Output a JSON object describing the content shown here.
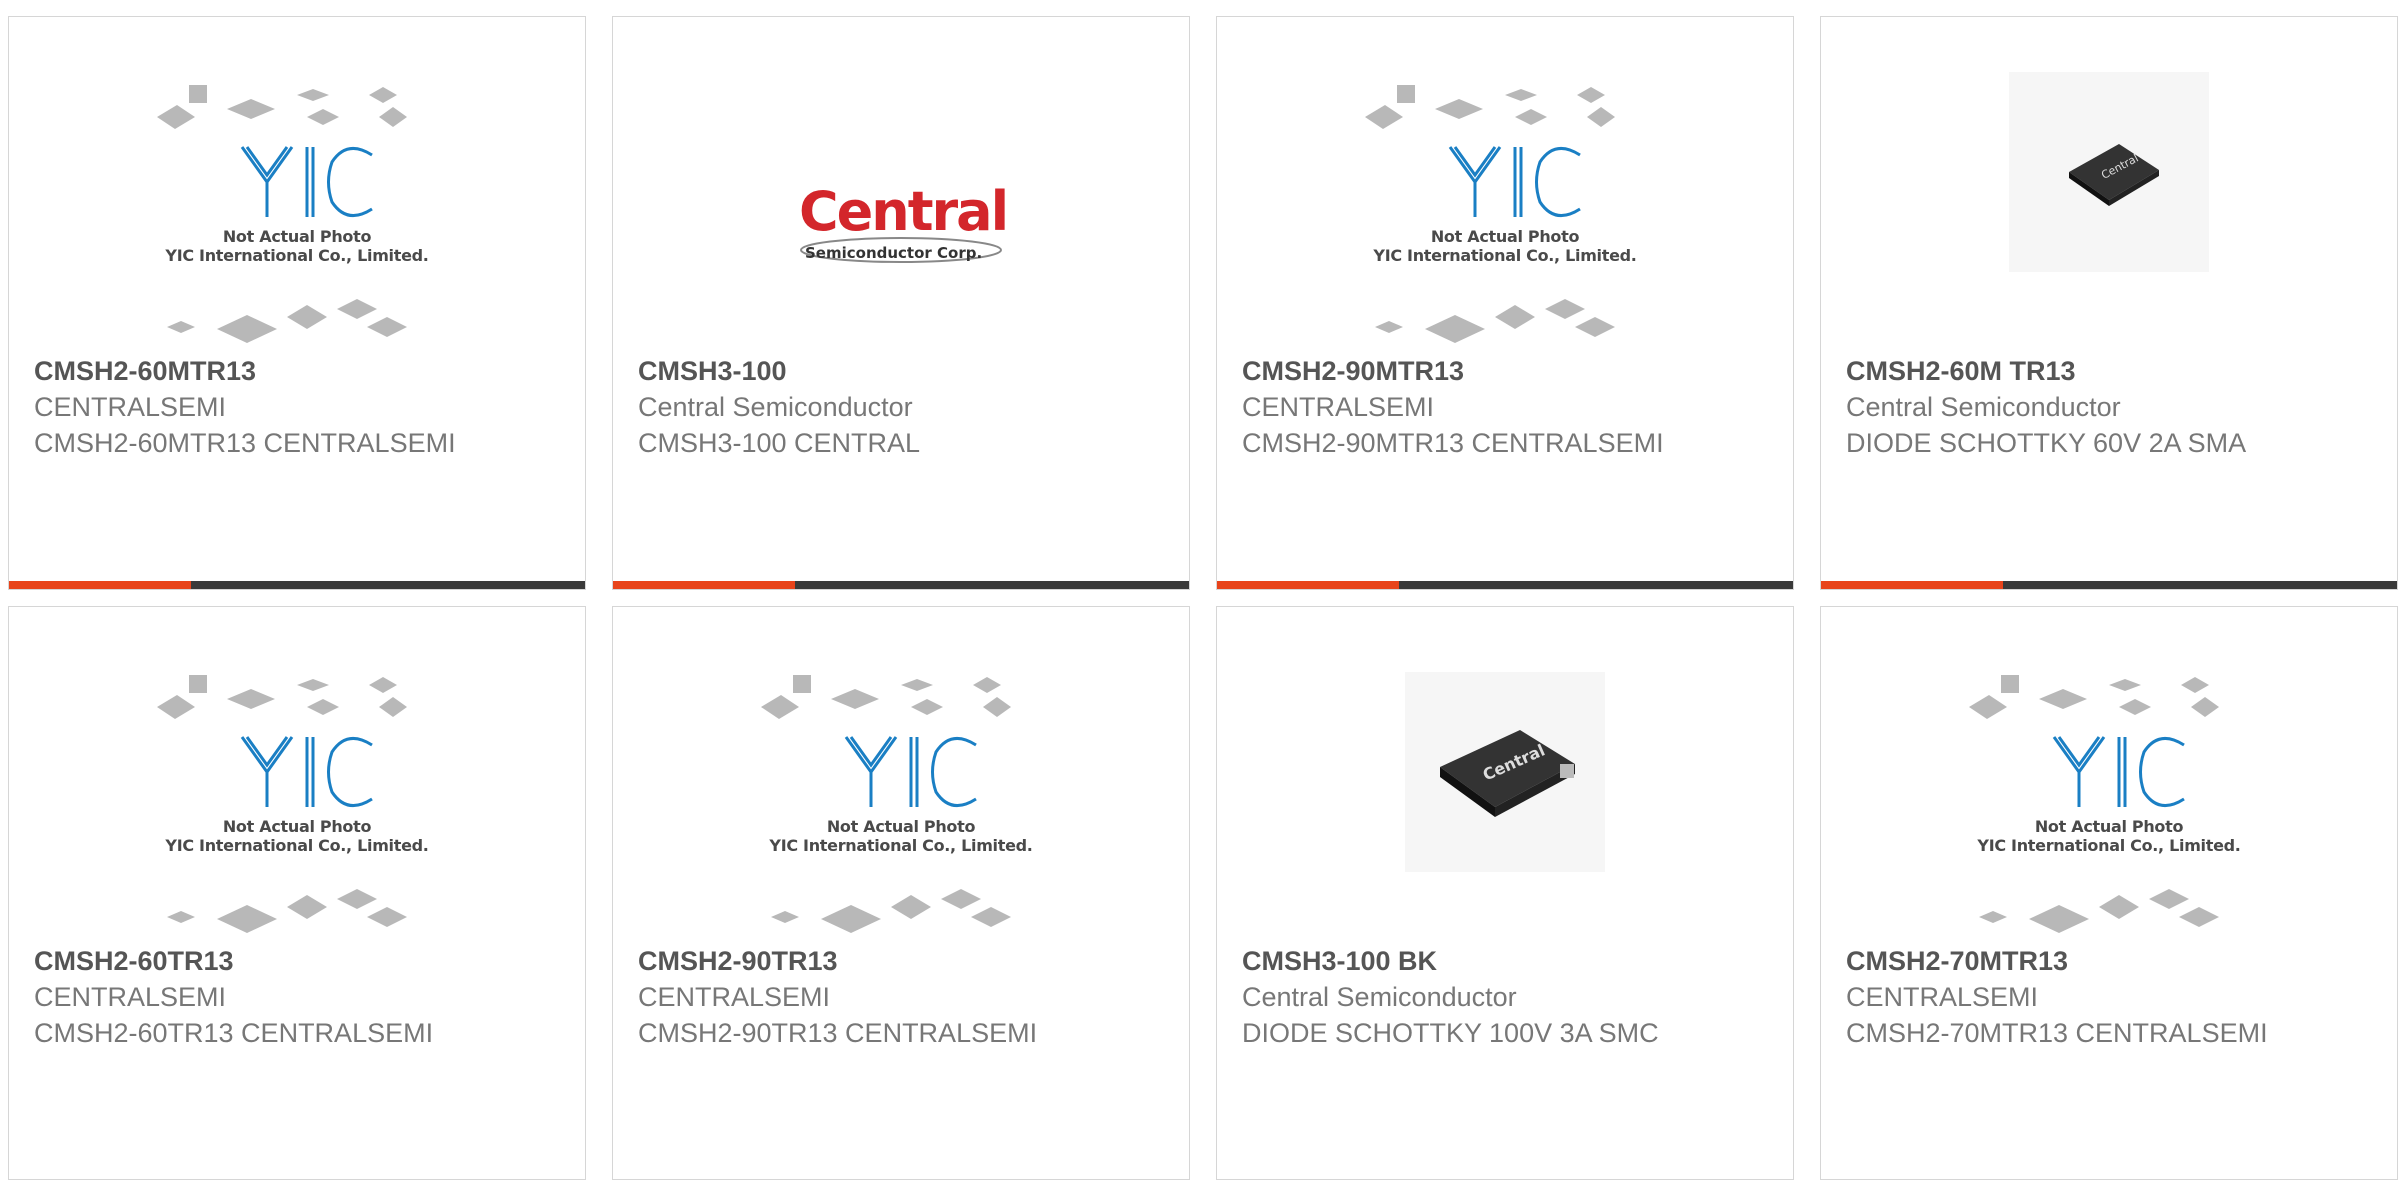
{
  "placeholder_caption": [
    "Not Actual Photo",
    "YIC International Co., Limited."
  ],
  "central_logo": {
    "word": "Central",
    "tm": "™",
    "sub": "Semiconductor Corp."
  },
  "colors": {
    "accent": "#e8441b",
    "bar": "#3a3a3a",
    "border": "#d6d6d6"
  },
  "products": [
    {
      "part": "CMSH2-60MTR13",
      "manufacturer": "CENTRALSEMI",
      "description": "CMSH2-60MTR13 CENTRALSEMI",
      "image": "placeholder"
    },
    {
      "part": "CMSH3-100",
      "manufacturer": "Central Semiconductor",
      "description": "CMSH3-100 CENTRAL",
      "image": "central-logo"
    },
    {
      "part": "CMSH2-90MTR13",
      "manufacturer": "CENTRALSEMI",
      "description": "CMSH2-90MTR13 CENTRALSEMI",
      "image": "placeholder"
    },
    {
      "part": "CMSH2-60M TR13",
      "manufacturer": "Central Semiconductor",
      "description": "DIODE SCHOTTKY 60V 2A SMA",
      "image": "chip-small"
    },
    {
      "part": "CMSH2-60TR13",
      "manufacturer": "CENTRALSEMI",
      "description": "CMSH2-60TR13 CENTRALSEMI",
      "image": "placeholder"
    },
    {
      "part": "CMSH2-90TR13",
      "manufacturer": "CENTRALSEMI",
      "description": "CMSH2-90TR13 CENTRALSEMI",
      "image": "placeholder"
    },
    {
      "part": "CMSH3-100 BK",
      "manufacturer": "Central Semiconductor",
      "description": "DIODE SCHOTTKY 100V 3A SMC",
      "image": "chip-large"
    },
    {
      "part": "CMSH2-70MTR13",
      "manufacturer": "CENTRALSEMI",
      "description": "CMSH2-70MTR13 CENTRALSEMI",
      "image": "placeholder"
    }
  ]
}
